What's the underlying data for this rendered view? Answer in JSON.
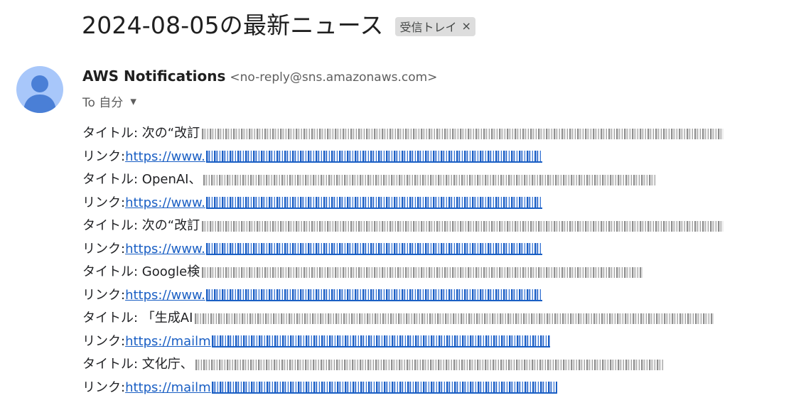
{
  "email": {
    "subject": "2024-08-05の最新ニュース",
    "label_chip": "受信トレイ",
    "label_close": "×",
    "sender": {
      "name": "AWS Notifications",
      "email": "<no-reply@sns.amazonaws.com>"
    },
    "recipient": {
      "label": "To 自分",
      "caret": "▾"
    }
  },
  "items": [
    {
      "title_prefix": "タイトル: 次の“改訂",
      "link_prefix": "https://www."
    },
    {
      "title_prefix": "タイトル: OpenAI、",
      "link_prefix": "https://www."
    },
    {
      "title_prefix": "タイトル: 次の“改訂",
      "link_prefix": "https://www."
    },
    {
      "title_prefix": "タイトル: Google検",
      "link_prefix": "https://www."
    },
    {
      "title_prefix": "タイトル: 「生成AI",
      "link_prefix": "https://mailm"
    },
    {
      "title_prefix": "タイトル: 文化庁、",
      "link_prefix": "https://mailm"
    }
  ],
  "link_label": "リンク: ",
  "colors": {
    "link": "#1a5fc4",
    "avatar_bg": "#a8c7fa",
    "avatar_fg": "#4a7fd6",
    "chip_bg": "#dddddd"
  }
}
